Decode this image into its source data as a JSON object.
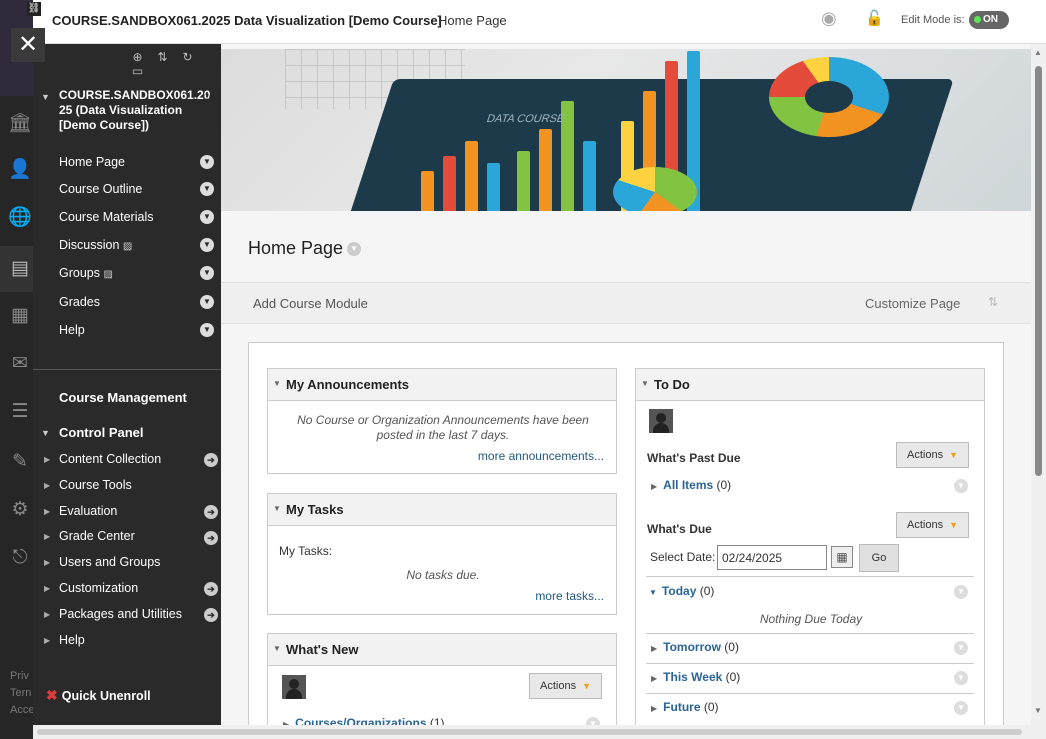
{
  "topbar": {
    "course_title": "COURSE.SANDBOX061.2025 Data Visualization [Demo Course]",
    "breadcrumb": "Home Page",
    "edit_mode_label": "Edit Mode is:",
    "edit_mode_value": "ON"
  },
  "rail": {
    "footer_lines": [
      "Priv",
      "Tern",
      "Acce"
    ]
  },
  "course_menu": {
    "course_name": "COURSE.SANDBOX061.2025 (Data Visualization [Demo Course])",
    "course_name_lines": [
      "COURSE.SANDBOX061.20",
      "25 (Data Visualization",
      "[Demo Course])"
    ],
    "items": [
      {
        "label": "Home Page"
      },
      {
        "label": "Course Outline"
      },
      {
        "label": "Course Materials"
      },
      {
        "label": "Discussion"
      },
      {
        "label": "Groups"
      },
      {
        "label": "Grades"
      },
      {
        "label": "Help"
      }
    ],
    "course_management": "Course Management",
    "control_panel": "Control Panel",
    "control_panel_items": [
      {
        "label": "Content Collection"
      },
      {
        "label": "Course Tools"
      },
      {
        "label": "Evaluation"
      },
      {
        "label": "Grade Center"
      },
      {
        "label": "Users and Groups"
      },
      {
        "label": "Customization"
      },
      {
        "label": "Packages and Utilities"
      },
      {
        "label": "Help"
      }
    ],
    "quick_unenroll": "Quick Unenroll"
  },
  "banner": {
    "board_text": "DATA COURSE"
  },
  "page": {
    "title": "Home Page",
    "add_module": "Add Course Module",
    "customize": "Customize Page"
  },
  "announcements": {
    "title": "My Announcements",
    "message": "No Course or Organization Announcements have been posted in the last 7 days.",
    "more": "more announcements..."
  },
  "tasks": {
    "title": "My Tasks",
    "label": "My Tasks:",
    "message": "No tasks due.",
    "more": "more tasks..."
  },
  "whats_new": {
    "title": "What's New",
    "actions": "Actions",
    "item_label": "Courses/Organizations",
    "item_count": "(1)"
  },
  "todo": {
    "title": "To Do",
    "past_due_title": "What's Past Due",
    "actions": "Actions",
    "all_items_label": "All Items",
    "all_items_count": "(0)",
    "due_title": "What's Due",
    "select_date_label": "Select Date:",
    "date_value": "02/24/2025",
    "go": "Go",
    "today_label": "Today",
    "today_count": "(0)",
    "nothing_due": "Nothing Due Today",
    "tomorrow_label": "Tomorrow",
    "tomorrow_count": "(0)",
    "this_week_label": "This Week",
    "this_week_count": "(0)",
    "future_label": "Future",
    "future_count": "(0)"
  }
}
